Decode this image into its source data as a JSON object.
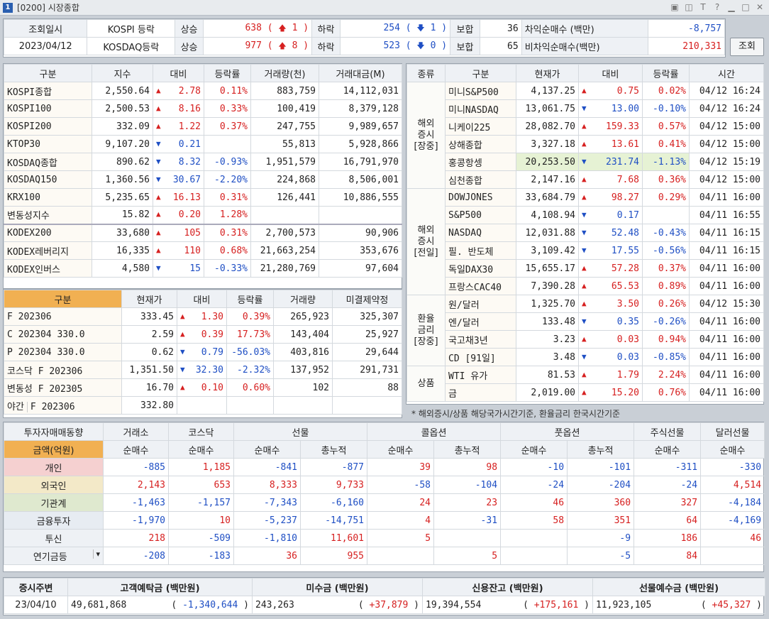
{
  "window": {
    "title": "[0200] 시장종합",
    "icon": "1"
  },
  "top": {
    "date_label": "조회일시",
    "date": "2023/04/12",
    "rows": [
      {
        "name": "KOSPI 등락",
        "up_label": "상승",
        "up": "638",
        "up_lim": "1",
        "down_label": "하락",
        "down": "254",
        "down_lim": "1",
        "flat_label": "보합",
        "flat": "36"
      },
      {
        "name": "KOSDAQ등락",
        "up_label": "상승",
        "up": "977",
        "up_lim": "8",
        "down_label": "하락",
        "down": "523",
        "down_lim": "0",
        "flat_label": "보합",
        "flat": "65"
      }
    ],
    "arb": [
      {
        "label": "차익순매수  (백만)",
        "value": "-8,757"
      },
      {
        "label": "비차익순매수(백만)",
        "value": "210,331"
      }
    ],
    "query_button": "조회"
  },
  "index": {
    "headers": [
      "구분",
      "지수",
      "대비",
      "등락률",
      "거래량(천)",
      "거래대금(M)"
    ],
    "rows": [
      [
        "KOSPI종합",
        "2,550.64",
        "up",
        "2.78",
        "0.11%",
        "883,759",
        "14,112,031"
      ],
      [
        "KOSPI100",
        "2,500.53",
        "up",
        "8.16",
        "0.33%",
        "100,419",
        "8,379,128"
      ],
      [
        "KOSPI200",
        "332.09",
        "up",
        "1.22",
        "0.37%",
        "247,755",
        "9,989,657"
      ],
      [
        "KTOP30",
        "9,107.20",
        "dn",
        "0.21",
        "",
        "55,813",
        "5,928,866"
      ],
      [
        "KOSDAQ종합",
        "890.62",
        "dn",
        "8.32",
        "-0.93%",
        "1,951,579",
        "16,791,970"
      ],
      [
        "KOSDAQ150",
        "1,360.56",
        "dn",
        "30.67",
        "-2.20%",
        "224,868",
        "8,506,001"
      ],
      [
        "KRX100",
        "5,235.65",
        "up",
        "16.13",
        "0.31%",
        "126,441",
        "10,886,555"
      ],
      [
        "변동성지수",
        "15.82",
        "up",
        "0.20",
        "1.28%",
        "",
        ""
      ],
      [
        "KODEX200",
        "33,680",
        "up",
        "105",
        "0.31%",
        "2,700,573",
        "90,906"
      ],
      [
        "KODEX레버리지",
        "16,335",
        "up",
        "110",
        "0.68%",
        "21,663,254",
        "353,676"
      ],
      [
        "KODEX인버스",
        "4,580",
        "dn",
        "15",
        "-0.33%",
        "21,280,769",
        "97,604"
      ]
    ]
  },
  "deriv": {
    "headers": [
      "구분",
      "현재가",
      "대비",
      "등락률",
      "거래량",
      "미결제약정"
    ],
    "rows": [
      [
        "F 202306",
        "333.45",
        "up",
        "1.30",
        "0.39%",
        "265,923",
        "325,307"
      ],
      [
        "C 202304 330.0",
        "2.59",
        "up",
        "0.39",
        "17.73%",
        "143,404",
        "25,927"
      ],
      [
        "P 202304 330.0",
        "0.62",
        "dn",
        "0.79",
        "-56.03%",
        "403,816",
        "29,644"
      ],
      [
        "코스닥 F 202306",
        "1,351.50",
        "dn",
        "32.30",
        "-2.32%",
        "137,952",
        "291,731"
      ],
      [
        "변동성 F 202305",
        "16.70",
        "up",
        "0.10",
        "0.60%",
        "102",
        "88"
      ]
    ],
    "night": {
      "tag": "야간",
      "name": "F 202306",
      "price": "332.80"
    }
  },
  "world": {
    "headers": [
      "종류",
      "구분",
      "현재가",
      "대비",
      "등락률",
      "시간"
    ],
    "groups": [
      {
        "label": "해외\n증시\n[장중]",
        "rows": [
          [
            "미니S&P500",
            "4,137.25",
            "up",
            "0.75",
            "0.02%",
            "04/12 16:24"
          ],
          [
            "미니NASDAQ",
            "13,061.75",
            "dn",
            "13.00",
            "-0.10%",
            "04/12 16:24"
          ],
          [
            "니케이225",
            "28,082.70",
            "up",
            "159.33",
            "0.57%",
            "04/12 15:00"
          ],
          [
            "상해종합",
            "3,327.18",
            "up",
            "13.61",
            "0.41%",
            "04/12 15:00"
          ],
          [
            "홍콩항셍",
            "20,253.50",
            "dn",
            "231.74",
            "-1.13%",
            "04/12 15:19"
          ],
          [
            "심천종합",
            "2,147.16",
            "up",
            "7.68",
            "0.36%",
            "04/12 15:00"
          ]
        ]
      },
      {
        "label": "해외\n증시\n[전일]",
        "rows": [
          [
            "DOWJONES",
            "33,684.79",
            "up",
            "98.27",
            "0.29%",
            "04/11 16:00"
          ],
          [
            "S&P500",
            "4,108.94",
            "dn",
            "0.17",
            "",
            "04/11 16:55"
          ],
          [
            "NASDAQ",
            "12,031.88",
            "dn",
            "52.48",
            "-0.43%",
            "04/11 16:15"
          ],
          [
            "필. 반도체",
            "3,109.42",
            "dn",
            "17.55",
            "-0.56%",
            "04/11 16:15"
          ],
          [
            "독일DAX30",
            "15,655.17",
            "up",
            "57.28",
            "0.37%",
            "04/11 16:00"
          ],
          [
            "프랑스CAC40",
            "7,390.28",
            "up",
            "65.53",
            "0.89%",
            "04/11 16:00"
          ]
        ]
      },
      {
        "label": "환율\n금리\n[장중]",
        "rows": [
          [
            "원/달러",
            "1,325.70",
            "up",
            "3.50",
            "0.26%",
            "04/12 15:30"
          ],
          [
            "엔/달러",
            "133.48",
            "dn",
            "0.35",
            "-0.26%",
            "04/11 16:00"
          ],
          [
            "국고채3년",
            "3.23",
            "up",
            "0.03",
            "0.94%",
            "04/11 16:00"
          ],
          [
            "CD [91일]",
            "3.48",
            "dn",
            "0.03",
            "-0.85%",
            "04/11 16:00"
          ]
        ]
      },
      {
        "label": "상품",
        "rows": [
          [
            "WTI 유가",
            "81.53",
            "up",
            "1.79",
            "2.24%",
            "04/11 16:00"
          ],
          [
            "금",
            "2,019.00",
            "up",
            "15.20",
            "0.76%",
            "04/11 16:00"
          ]
        ]
      }
    ],
    "note": "* 해외증시/상품 해당국가시간기준, 환율금리 한국시간기준"
  },
  "investor": {
    "title": "투자자매매동향",
    "unit": "금액(억원)",
    "groups": [
      "거래소",
      "코스닥",
      "선물",
      "콜옵션",
      "풋옵션",
      "주식선물",
      "달러선물"
    ],
    "sub": [
      "순매수",
      "순매수",
      "순매수",
      "총누적",
      "순매수",
      "총누적",
      "순매수",
      "총누적",
      "순매수",
      "순매수"
    ],
    "rows": [
      {
        "name": "개인",
        "vals": [
          "-885",
          "1,185",
          "-841",
          "-877",
          "39",
          "98",
          "-10",
          "-101",
          "-311",
          "-330"
        ]
      },
      {
        "name": "외국인",
        "vals": [
          "2,143",
          "653",
          "8,333",
          "9,733",
          "-58",
          "-104",
          "-24",
          "-204",
          "-24",
          "4,514"
        ]
      },
      {
        "name": "기관계",
        "vals": [
          "-1,463",
          "-1,157",
          "-7,343",
          "-6,160",
          "24",
          "23",
          "46",
          "360",
          "327",
          "-4,184"
        ]
      },
      {
        "name": "금융투자",
        "vals": [
          "-1,970",
          "10",
          "-5,237",
          "-14,751",
          "4",
          "-31",
          "58",
          "351",
          "64",
          "-4,169"
        ]
      },
      {
        "name": "투신",
        "vals": [
          "218",
          "-509",
          "-1,810",
          "11,601",
          "5",
          "",
          "",
          "-9",
          "186",
          "46"
        ]
      },
      {
        "name": "연기금등",
        "vals": [
          "-208",
          "-183",
          "36",
          "955",
          "",
          "5",
          "",
          "-5",
          "84",
          ""
        ]
      }
    ]
  },
  "bottom": {
    "headers": [
      "증시주변",
      "고객예탁금 (백만원)",
      "미수금 (백만원)",
      "신용잔고 (백만원)",
      "선물예수금 (백만원)"
    ],
    "date": "23/04/10",
    "items": [
      {
        "v": "49,681,868",
        "d": "-1,340,644"
      },
      {
        "v": "243,263",
        "d": "+37,879"
      },
      {
        "v": "19,394,554",
        "d": "+175,161"
      },
      {
        "v": "11,923,105",
        "d": "+45,327"
      }
    ]
  }
}
